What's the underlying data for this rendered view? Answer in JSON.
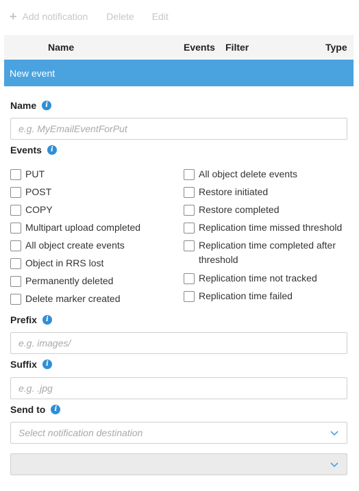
{
  "toolbar": {
    "add_label": "Add notification",
    "delete_label": "Delete",
    "edit_label": "Edit"
  },
  "table": {
    "columns": [
      "Name",
      "Events",
      "Filter",
      "Type"
    ]
  },
  "banner": {
    "title": "New event"
  },
  "form": {
    "name": {
      "label": "Name",
      "placeholder": "e.g. MyEmailEventForPut",
      "value": ""
    },
    "events": {
      "label": "Events",
      "left": [
        "PUT",
        "POST",
        "COPY",
        "Multipart upload completed",
        "All object create events",
        "Object in RRS lost",
        "Permanently deleted",
        "Delete marker created"
      ],
      "right": [
        "All object delete events",
        "Restore initiated",
        "Restore completed",
        "Replication time missed threshold",
        "Replication time completed after threshold",
        "Replication time not tracked",
        "Replication time failed"
      ]
    },
    "prefix": {
      "label": "Prefix",
      "placeholder": "e.g. images/",
      "value": ""
    },
    "suffix": {
      "label": "Suffix",
      "placeholder": "e.g. .jpg",
      "value": ""
    },
    "send_to": {
      "label": "Send to",
      "placeholder": "Select notification destination",
      "second_value": ""
    }
  },
  "colors": {
    "accent": "#4aa3df",
    "info": "#2f8fd6",
    "disabled_text": "#c7c7c7"
  }
}
